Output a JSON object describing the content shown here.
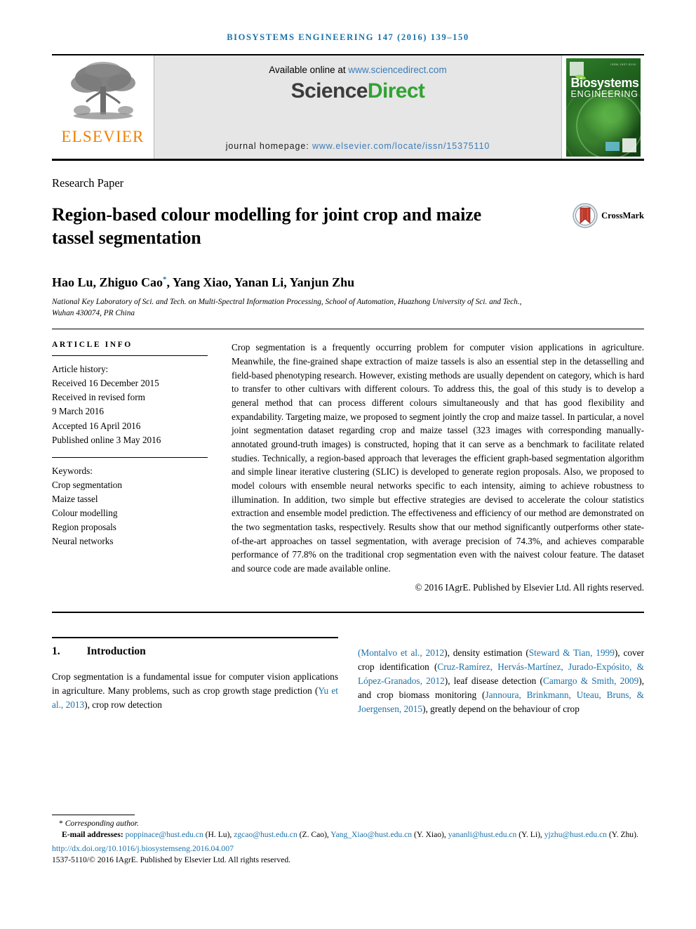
{
  "running_head": "BIOSYSTEMS ENGINEERING 147 (2016) 139–150",
  "masthead": {
    "publisher_name": "ELSEVIER",
    "available_prefix": "Available online at ",
    "available_url": "www.sciencedirect.com",
    "logo_part1": "Science",
    "logo_part2": "Direct",
    "homepage_label": "journal homepage: ",
    "homepage_url": "www.elsevier.com/locate/issn/15375110",
    "cover": {
      "title_line1": "Biosystems",
      "title_line2": "ENGINEERING",
      "issn_corner": "ISSN 1537-5110"
    }
  },
  "article": {
    "kicker": "Research Paper",
    "title": "Region-based colour modelling for joint crop and maize tassel segmentation",
    "crossmark_label": "CrossMark",
    "authors": "Hao Lu, Zhiguo Cao",
    "authors_rest": ", Yang Xiao, Yanan Li, Yanjun Zhu",
    "author_star": "*",
    "affiliation": "National Key Laboratory of Sci. and Tech. on Multi-Spectral Information Processing, School of Automation, Huazhong University of Sci. and Tech., Wuhan 430074, PR China"
  },
  "article_info": {
    "heading": "ARTICLE INFO",
    "history_label": "Article history:",
    "history": [
      "Received 16 December 2015",
      "Received in revised form",
      "9 March 2016",
      "Accepted 16 April 2016",
      "Published online 3 May 2016"
    ],
    "keywords_label": "Keywords:",
    "keywords": [
      "Crop segmentation",
      "Maize tassel",
      "Colour modelling",
      "Region proposals",
      "Neural networks"
    ]
  },
  "abstract": {
    "text": "Crop segmentation is a frequently occurring problem for computer vision applications in agriculture. Meanwhile, the fine-grained shape extraction of maize tassels is also an essential step in the detasselling and field-based phenotyping research. However, existing methods are usually dependent on category, which is hard to transfer to other cultivars with different colours. To address this, the goal of this study is to develop a general method that can process different colours simultaneously and that has good flexibility and expandability. Targeting maize, we proposed to segment jointly the crop and maize tassel. In particular, a novel joint segmentation dataset regarding crop and maize tassel (323 images with corresponding manually-annotated ground-truth images) is constructed, hoping that it can serve as a benchmark to facilitate related studies. Technically, a region-based approach that leverages the efficient graph-based segmentation algorithm and simple linear iterative clustering (SLIC) is developed to generate region proposals. Also, we proposed to model colours with ensemble neural networks specific to each intensity, aiming to achieve robustness to illumination. In addition, two simple but effective strategies are devised to accelerate the colour statistics extraction and ensemble model prediction. The effectiveness and efficiency of our method are demonstrated on the two segmentation tasks, respectively. Results show that our method significantly outperforms other state-of-the-art approaches on tassel segmentation, with average precision of 74.3%, and achieves comparable performance of 77.8% on the traditional crop segmentation even with the naivest colour feature. The dataset and source code are made available online.",
    "copyright": "© 2016 IAgrE. Published by Elsevier Ltd. All rights reserved."
  },
  "introduction": {
    "number": "1.",
    "title": "Introduction",
    "left_before_cite": "Crop segmentation is a fundamental issue for computer vision applications in agriculture. Many problems, such as crop growth stage prediction (",
    "left_cite": "Yu et al., 2013",
    "left_after_cite": "), crop row detection",
    "right_segments": [
      {
        "type": "cite",
        "text": "(Montalvo et al., 2012"
      },
      {
        "type": "text",
        "text": "), density estimation ("
      },
      {
        "type": "cite",
        "text": "Steward & Tian, 1999"
      },
      {
        "type": "text",
        "text": "), cover crop identification ("
      },
      {
        "type": "cite",
        "text": "Cruz-Ramírez, Hervás-Martínez, Jurado-Expósito, & López-Granados, 2012"
      },
      {
        "type": "text",
        "text": "), leaf disease detection ("
      },
      {
        "type": "cite",
        "text": "Camargo & Smith, 2009"
      },
      {
        "type": "text",
        "text": "), and crop biomass monitoring ("
      },
      {
        "type": "cite",
        "text": "Jannoura, Brinkmann, Uteau, Bruns, & Joergensen, 2015"
      },
      {
        "type": "text",
        "text": "), greatly depend on the behaviour of crop"
      }
    ]
  },
  "footnotes": {
    "corresponding_star": "*",
    "corresponding_text": "Corresponding author.",
    "email_label": "E-mail addresses:",
    "emails": [
      {
        "address": "poppinace@hust.edu.cn",
        "owner": " (H. Lu), "
      },
      {
        "address": "zgcao@hust.edu.cn",
        "owner": " (Z. Cao), "
      },
      {
        "address": "Yang_Xiao@hust.edu.cn",
        "owner": " (Y. Xiao), "
      },
      {
        "address": "yananli@hust.edu.cn",
        "owner": " (Y. Li), "
      },
      {
        "address": "yjzhu@hust.edu.cn",
        "owner": " (Y. Zhu)."
      }
    ],
    "doi": "http://dx.doi.org/10.1016/j.biosystemseng.2016.04.007",
    "issn_line": "1537-5110/© 2016 IAgrE. Published by Elsevier Ltd. All rights reserved."
  },
  "colors": {
    "link_blue": "#1b72a8",
    "sciencedirect_green": "#32a232",
    "elsevier_orange": "#f08000",
    "crossmark_red": "#c0392b"
  }
}
